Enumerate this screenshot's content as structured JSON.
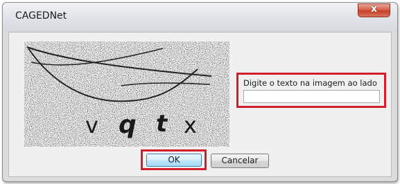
{
  "window": {
    "title": "CAGEDNet",
    "close_icon": "close-icon",
    "close_glyph": "x"
  },
  "captcha": {
    "letters": [
      "v",
      "q",
      "t",
      "x"
    ]
  },
  "prompt": {
    "label": "Digite o texto na imagem ao lado",
    "value": ""
  },
  "buttons": {
    "ok_label": "OK",
    "cancel_label": "Cancelar"
  },
  "colors": {
    "highlight": "#d31d2a",
    "close_button": "#c7412a",
    "default_button_border": "#3c7fb1"
  }
}
